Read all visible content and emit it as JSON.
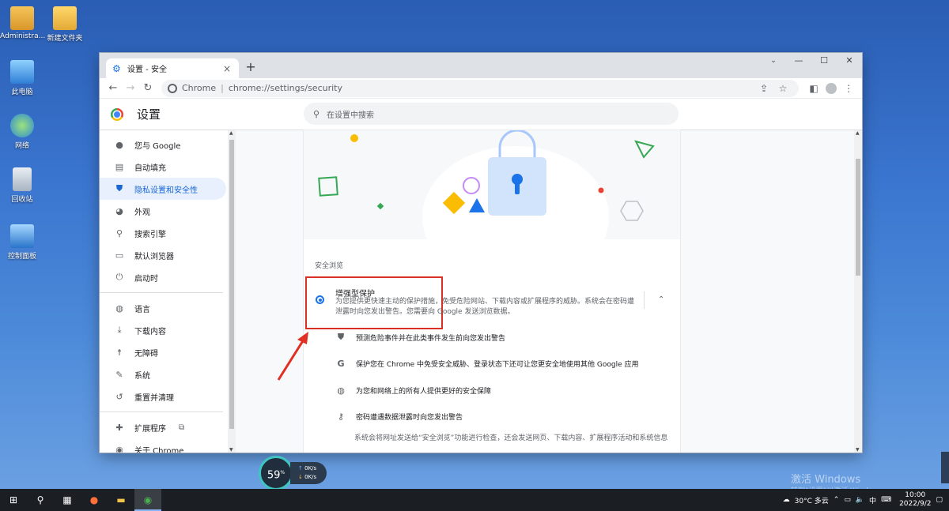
{
  "desktop": {
    "icons": [
      {
        "label": "Administra..."
      },
      {
        "label": "新建文件夹"
      },
      {
        "label": "此电脑"
      },
      {
        "label": "网络"
      },
      {
        "label": "回收站"
      },
      {
        "label": "控制面板"
      }
    ]
  },
  "browser": {
    "tab_title": "设置 - 安全",
    "new_tab": "+",
    "controls": {
      "menu": "⌄",
      "minimize": "—",
      "maximize": "☐",
      "close": "✕"
    },
    "omnibox": {
      "chip": "Chrome",
      "url": "chrome://settings/security"
    }
  },
  "settings": {
    "title": "设置",
    "search_placeholder": "在设置中搜索",
    "sidebar": [
      {
        "label": "您与 Google",
        "icon": "person-icon"
      },
      {
        "label": "自动填充",
        "icon": "clipboard-icon"
      },
      {
        "label": "隐私设置和安全性",
        "icon": "shield-icon"
      },
      {
        "label": "外观",
        "icon": "palette-icon"
      },
      {
        "label": "搜索引擎",
        "icon": "search-icon"
      },
      {
        "label": "默认浏览器",
        "icon": "browser-icon"
      },
      {
        "label": "启动时",
        "icon": "power-icon"
      },
      {
        "label": "语言",
        "icon": "globe-icon"
      },
      {
        "label": "下载内容",
        "icon": "download-icon"
      },
      {
        "label": "无障碍",
        "icon": "accessibility-icon"
      },
      {
        "label": "系统",
        "icon": "wrench-icon"
      },
      {
        "label": "重置并清理",
        "icon": "history-icon"
      },
      {
        "label": "扩展程序",
        "icon": "puzzle-icon"
      },
      {
        "label": "关于 Chrome",
        "icon": "chrome-icon"
      }
    ],
    "section_heading": "安全浏览",
    "enhanced": {
      "title": "增强型保护",
      "desc": "为您提供更快速主动的保护措施，免受危险网站、下载内容或扩展程序的威胁。系统会在密码遭泄露时向您发出警告。您需要向 Google 发送浏览数据。"
    },
    "features": [
      {
        "text": "预测危险事件并在此类事件发生前向您发出警告",
        "icon": "shield-icon"
      },
      {
        "text": "保护您在 Chrome 中免受安全威胁、登录状态下还可让您更安全地使用其他 Google 应用",
        "icon": "google-g-icon"
      },
      {
        "text": "为您和网络上的所有人提供更好的安全保障",
        "icon": "globe-icon"
      },
      {
        "text": "密码遭遇数据泄露时向您发出警告",
        "icon": "key-icon"
      }
    ],
    "feature_desc": "系统会将网址发送给“安全浏览”功能进行检查，还会发送网页、下载内容、扩展程序活动和系统信息"
  },
  "speed_widget": {
    "percent": "59",
    "percent_unit": "%",
    "up": "0K/s",
    "down": "0K/s"
  },
  "watermark": {
    "line1": "激活 Windows",
    "line2": "转到“设置”以激活 Windows。"
  },
  "taskbar": {
    "weather": "30°C 多云",
    "ime": "中",
    "time": "10:00",
    "date": "2022/9/2"
  },
  "colors": {
    "accent": "#1a73e8",
    "highlight": "#d93025",
    "active_bg": "#e8f0fe"
  }
}
